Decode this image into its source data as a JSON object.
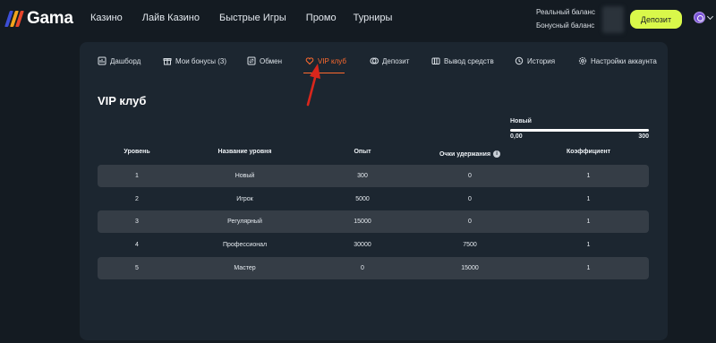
{
  "brand": {
    "name": "Gama",
    "colors": [
      "#3d4fd6",
      "#f2a51c",
      "#e8462c"
    ]
  },
  "nav": {
    "items": [
      "Казино",
      "Лайв Казино",
      "Быстрые Игры",
      "Промо",
      "Турниры"
    ]
  },
  "balance": {
    "real_label": "Реальный баланс",
    "bonus_label": "Бонусный баланс"
  },
  "header": {
    "deposit_label": "Депозит",
    "avatar_icon": "user-circle-icon"
  },
  "tabs": [
    {
      "label": "Дашборд",
      "icon": "dashboard-icon"
    },
    {
      "label": "Мои бонусы (3)",
      "icon": "gift-icon"
    },
    {
      "label": "Обмен",
      "icon": "exchange-icon"
    },
    {
      "label": "VIP клуб",
      "icon": "heart-icon",
      "active": true
    },
    {
      "label": "Депозит",
      "icon": "coins-icon"
    },
    {
      "label": "Вывод средств",
      "icon": "wallet-icon"
    },
    {
      "label": "История",
      "icon": "history-icon"
    },
    {
      "label": "Настройки аккаунта",
      "icon": "gear-icon"
    }
  ],
  "accent_color": "#ff6a2e",
  "page": {
    "title": "VIP клуб"
  },
  "progress": {
    "level_name": "Новый",
    "min_label": "0,00",
    "max_label": "300",
    "fraction": 1.0
  },
  "table": {
    "headers": [
      "Уровень",
      "Название уровня",
      "Опыт",
      "Очки удержания",
      "Коэффициент"
    ],
    "rows": [
      [
        "1",
        "Новый",
        "300",
        "0",
        "1"
      ],
      [
        "2",
        "Игрок",
        "5000",
        "0",
        "1"
      ],
      [
        "3",
        "Регулярный",
        "15000",
        "0",
        "1"
      ],
      [
        "4",
        "Профессионал",
        "30000",
        "7500",
        "1"
      ],
      [
        "5",
        "Мастер",
        "0",
        "15000",
        "1"
      ]
    ]
  }
}
